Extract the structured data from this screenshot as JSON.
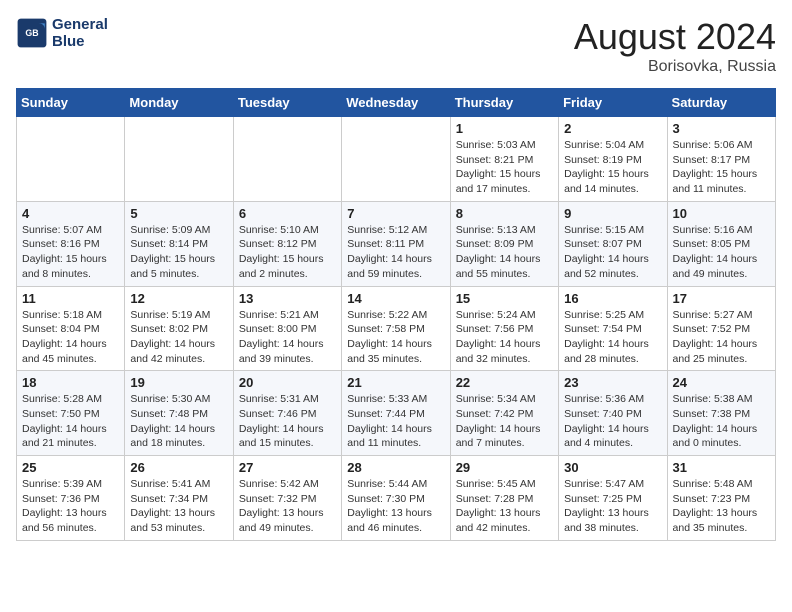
{
  "header": {
    "logo_line1": "General",
    "logo_line2": "Blue",
    "month": "August 2024",
    "location": "Borisovka, Russia"
  },
  "weekdays": [
    "Sunday",
    "Monday",
    "Tuesday",
    "Wednesday",
    "Thursday",
    "Friday",
    "Saturday"
  ],
  "weeks": [
    [
      {
        "day": "",
        "info": ""
      },
      {
        "day": "",
        "info": ""
      },
      {
        "day": "",
        "info": ""
      },
      {
        "day": "",
        "info": ""
      },
      {
        "day": "1",
        "info": "Sunrise: 5:03 AM\nSunset: 8:21 PM\nDaylight: 15 hours\nand 17 minutes."
      },
      {
        "day": "2",
        "info": "Sunrise: 5:04 AM\nSunset: 8:19 PM\nDaylight: 15 hours\nand 14 minutes."
      },
      {
        "day": "3",
        "info": "Sunrise: 5:06 AM\nSunset: 8:17 PM\nDaylight: 15 hours\nand 11 minutes."
      }
    ],
    [
      {
        "day": "4",
        "info": "Sunrise: 5:07 AM\nSunset: 8:16 PM\nDaylight: 15 hours\nand 8 minutes."
      },
      {
        "day": "5",
        "info": "Sunrise: 5:09 AM\nSunset: 8:14 PM\nDaylight: 15 hours\nand 5 minutes."
      },
      {
        "day": "6",
        "info": "Sunrise: 5:10 AM\nSunset: 8:12 PM\nDaylight: 15 hours\nand 2 minutes."
      },
      {
        "day": "7",
        "info": "Sunrise: 5:12 AM\nSunset: 8:11 PM\nDaylight: 14 hours\nand 59 minutes."
      },
      {
        "day": "8",
        "info": "Sunrise: 5:13 AM\nSunset: 8:09 PM\nDaylight: 14 hours\nand 55 minutes."
      },
      {
        "day": "9",
        "info": "Sunrise: 5:15 AM\nSunset: 8:07 PM\nDaylight: 14 hours\nand 52 minutes."
      },
      {
        "day": "10",
        "info": "Sunrise: 5:16 AM\nSunset: 8:05 PM\nDaylight: 14 hours\nand 49 minutes."
      }
    ],
    [
      {
        "day": "11",
        "info": "Sunrise: 5:18 AM\nSunset: 8:04 PM\nDaylight: 14 hours\nand 45 minutes."
      },
      {
        "day": "12",
        "info": "Sunrise: 5:19 AM\nSunset: 8:02 PM\nDaylight: 14 hours\nand 42 minutes."
      },
      {
        "day": "13",
        "info": "Sunrise: 5:21 AM\nSunset: 8:00 PM\nDaylight: 14 hours\nand 39 minutes."
      },
      {
        "day": "14",
        "info": "Sunrise: 5:22 AM\nSunset: 7:58 PM\nDaylight: 14 hours\nand 35 minutes."
      },
      {
        "day": "15",
        "info": "Sunrise: 5:24 AM\nSunset: 7:56 PM\nDaylight: 14 hours\nand 32 minutes."
      },
      {
        "day": "16",
        "info": "Sunrise: 5:25 AM\nSunset: 7:54 PM\nDaylight: 14 hours\nand 28 minutes."
      },
      {
        "day": "17",
        "info": "Sunrise: 5:27 AM\nSunset: 7:52 PM\nDaylight: 14 hours\nand 25 minutes."
      }
    ],
    [
      {
        "day": "18",
        "info": "Sunrise: 5:28 AM\nSunset: 7:50 PM\nDaylight: 14 hours\nand 21 minutes."
      },
      {
        "day": "19",
        "info": "Sunrise: 5:30 AM\nSunset: 7:48 PM\nDaylight: 14 hours\nand 18 minutes."
      },
      {
        "day": "20",
        "info": "Sunrise: 5:31 AM\nSunset: 7:46 PM\nDaylight: 14 hours\nand 15 minutes."
      },
      {
        "day": "21",
        "info": "Sunrise: 5:33 AM\nSunset: 7:44 PM\nDaylight: 14 hours\nand 11 minutes."
      },
      {
        "day": "22",
        "info": "Sunrise: 5:34 AM\nSunset: 7:42 PM\nDaylight: 14 hours\nand 7 minutes."
      },
      {
        "day": "23",
        "info": "Sunrise: 5:36 AM\nSunset: 7:40 PM\nDaylight: 14 hours\nand 4 minutes."
      },
      {
        "day": "24",
        "info": "Sunrise: 5:38 AM\nSunset: 7:38 PM\nDaylight: 14 hours\nand 0 minutes."
      }
    ],
    [
      {
        "day": "25",
        "info": "Sunrise: 5:39 AM\nSunset: 7:36 PM\nDaylight: 13 hours\nand 56 minutes."
      },
      {
        "day": "26",
        "info": "Sunrise: 5:41 AM\nSunset: 7:34 PM\nDaylight: 13 hours\nand 53 minutes."
      },
      {
        "day": "27",
        "info": "Sunrise: 5:42 AM\nSunset: 7:32 PM\nDaylight: 13 hours\nand 49 minutes."
      },
      {
        "day": "28",
        "info": "Sunrise: 5:44 AM\nSunset: 7:30 PM\nDaylight: 13 hours\nand 46 minutes."
      },
      {
        "day": "29",
        "info": "Sunrise: 5:45 AM\nSunset: 7:28 PM\nDaylight: 13 hours\nand 42 minutes."
      },
      {
        "day": "30",
        "info": "Sunrise: 5:47 AM\nSunset: 7:25 PM\nDaylight: 13 hours\nand 38 minutes."
      },
      {
        "day": "31",
        "info": "Sunrise: 5:48 AM\nSunset: 7:23 PM\nDaylight: 13 hours\nand 35 minutes."
      }
    ]
  ]
}
